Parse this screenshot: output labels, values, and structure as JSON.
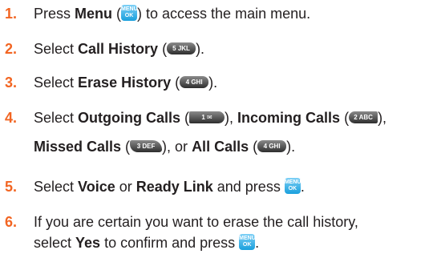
{
  "steps": [
    {
      "num": "1.",
      "t1": "Press ",
      "b1": "Menu",
      "t2": " (",
      "t3": ") to access the main menu.",
      "menu": {
        "l1": "MENU",
        "l2": "OK"
      }
    },
    {
      "num": "2.",
      "t1": "Select ",
      "b1": "Call History",
      "t2": " (",
      "t3": ").",
      "key": "5 JKL"
    },
    {
      "num": "3.",
      "t1": "Select ",
      "b1": "Erase History",
      "t2": " (",
      "t3": ").",
      "key": "4 GHI"
    },
    {
      "num": "4.",
      "line1": {
        "t1": "Select ",
        "b1": "Outgoing Calls",
        "t2": " (",
        "t3": "), ",
        "b2": "Incoming Calls",
        "t4": " (",
        "t5": "),"
      },
      "line2": {
        "b1": "Missed Calls",
        "t1": " (",
        "t2": "), or ",
        "b2": "All Calls",
        "t3": " (",
        "t4": ")."
      },
      "keys": {
        "outgoing": "1 ✉",
        "incoming": "2 ABC",
        "missed": "3 DEF",
        "all": "4 GHI"
      }
    },
    {
      "num": "5.",
      "t1": "Select ",
      "b1": "Voice",
      "t2": " or ",
      "b2": "Ready Link",
      "t3": " and press ",
      "t4": ".",
      "menu": {
        "l1": "MENU",
        "l2": "OK"
      }
    },
    {
      "num": "6.",
      "line1": "If you are certain you want to erase the call history,",
      "line2": {
        "t1": "select ",
        "b1": "Yes",
        "t2": " to confirm and press ",
        "t3": "."
      },
      "menu": {
        "l1": "MENU",
        "l2": "OK"
      }
    }
  ]
}
